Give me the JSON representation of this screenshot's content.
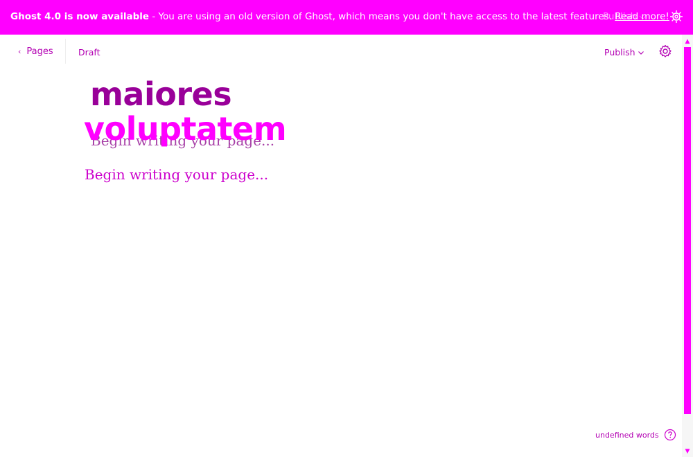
{
  "banner": {
    "strong": "Ghost 4.0 is now available",
    "dash": " - ",
    "message": "You are using an old version of Ghost, which means you don't have access to the latest features. ",
    "link": "Read more!",
    "ghost_left": "Pages    Draft",
    "ghost_publish": "Publish",
    "close_icon": "close-icon"
  },
  "header": {
    "back_label": "Pages",
    "status": "Draft",
    "publish_label": "Publish",
    "settings_icon": "gear-icon"
  },
  "editor": {
    "title_line1": "maiores",
    "title_line2": "voluptatem",
    "ghost_placeholder": "Begin writing your page...",
    "placeholder": "Begin writing your page..."
  },
  "footer": {
    "word_count": "undefined words",
    "help_icon": "question-icon"
  },
  "colors": {
    "accent": "#ff00ff",
    "accent_dark": "#990099",
    "text_link": "#b300b3"
  }
}
